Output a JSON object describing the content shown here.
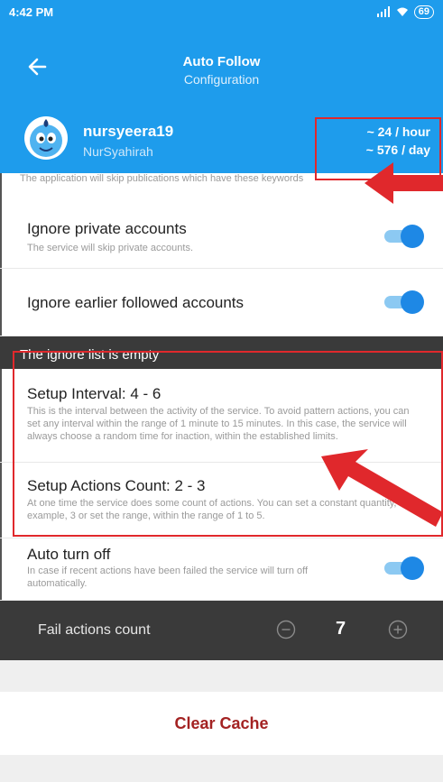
{
  "status": {
    "time": "4:42 PM",
    "signal": "..il",
    "wifi": "wifi",
    "battery": "69"
  },
  "header": {
    "title": "Auto Follow",
    "subtitle": "Configuration"
  },
  "user": {
    "username": "nursyeera19",
    "full_name": "NurSyahirah",
    "rate_hour": "~ 24 / hour",
    "rate_day": "~ 576 / day"
  },
  "cut_text": "The application will skip publications which have these keywords",
  "settings": {
    "ignore_private": {
      "title": "Ignore private accounts",
      "desc": "The service will skip private accounts."
    },
    "ignore_followed": {
      "title": "Ignore earlier followed accounts"
    },
    "ignore_list": "The ignore list is empty",
    "interval": {
      "title": "Setup Interval: 4 - 6",
      "desc": "This is the interval between the activity of the service. To avoid pattern actions, you can set any interval within the range of 1 minute to 15 minutes. In this case, the service will always choose a random time for inaction, within the established limits."
    },
    "actions_count": {
      "title": "Setup Actions Count: 2 - 3",
      "desc": "At one time the service does some count of actions. You can set a constant quantity, for example, 3 or set the range, within the range of 1 to 5."
    },
    "auto_off": {
      "title": "Auto turn off",
      "desc": "In case if recent actions have been failed the service will turn off automatically."
    },
    "fail_label": "Fail actions count",
    "fail_value": "7"
  },
  "clear_cache": "Clear Cache",
  "colors": {
    "primary": "#1e9cec",
    "toggle": "#1e88e5",
    "accent_red": "#e0282c",
    "dark": "#3a3a3a",
    "clear": "#a32222"
  }
}
